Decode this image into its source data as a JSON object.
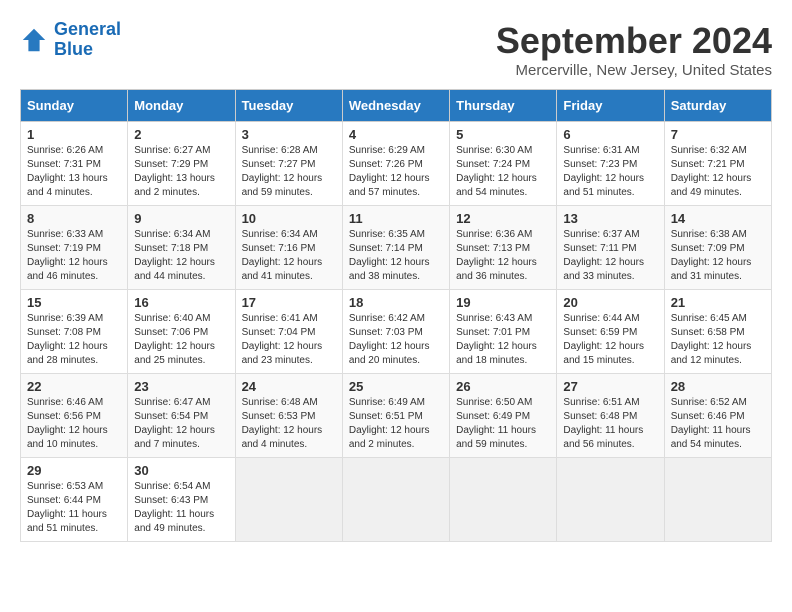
{
  "logo": {
    "line1": "General",
    "line2": "Blue"
  },
  "title": "September 2024",
  "location": "Mercerville, New Jersey, United States",
  "days_of_week": [
    "Sunday",
    "Monday",
    "Tuesday",
    "Wednesday",
    "Thursday",
    "Friday",
    "Saturday"
  ],
  "weeks": [
    [
      {
        "day": "1",
        "sunrise": "6:26 AM",
        "sunset": "7:31 PM",
        "daylight": "13 hours and 4 minutes."
      },
      {
        "day": "2",
        "sunrise": "6:27 AM",
        "sunset": "7:29 PM",
        "daylight": "13 hours and 2 minutes."
      },
      {
        "day": "3",
        "sunrise": "6:28 AM",
        "sunset": "7:27 PM",
        "daylight": "12 hours and 59 minutes."
      },
      {
        "day": "4",
        "sunrise": "6:29 AM",
        "sunset": "7:26 PM",
        "daylight": "12 hours and 57 minutes."
      },
      {
        "day": "5",
        "sunrise": "6:30 AM",
        "sunset": "7:24 PM",
        "daylight": "12 hours and 54 minutes."
      },
      {
        "day": "6",
        "sunrise": "6:31 AM",
        "sunset": "7:23 PM",
        "daylight": "12 hours and 51 minutes."
      },
      {
        "day": "7",
        "sunrise": "6:32 AM",
        "sunset": "7:21 PM",
        "daylight": "12 hours and 49 minutes."
      }
    ],
    [
      {
        "day": "8",
        "sunrise": "6:33 AM",
        "sunset": "7:19 PM",
        "daylight": "12 hours and 46 minutes."
      },
      {
        "day": "9",
        "sunrise": "6:34 AM",
        "sunset": "7:18 PM",
        "daylight": "12 hours and 44 minutes."
      },
      {
        "day": "10",
        "sunrise": "6:34 AM",
        "sunset": "7:16 PM",
        "daylight": "12 hours and 41 minutes."
      },
      {
        "day": "11",
        "sunrise": "6:35 AM",
        "sunset": "7:14 PM",
        "daylight": "12 hours and 38 minutes."
      },
      {
        "day": "12",
        "sunrise": "6:36 AM",
        "sunset": "7:13 PM",
        "daylight": "12 hours and 36 minutes."
      },
      {
        "day": "13",
        "sunrise": "6:37 AM",
        "sunset": "7:11 PM",
        "daylight": "12 hours and 33 minutes."
      },
      {
        "day": "14",
        "sunrise": "6:38 AM",
        "sunset": "7:09 PM",
        "daylight": "12 hours and 31 minutes."
      }
    ],
    [
      {
        "day": "15",
        "sunrise": "6:39 AM",
        "sunset": "7:08 PM",
        "daylight": "12 hours and 28 minutes."
      },
      {
        "day": "16",
        "sunrise": "6:40 AM",
        "sunset": "7:06 PM",
        "daylight": "12 hours and 25 minutes."
      },
      {
        "day": "17",
        "sunrise": "6:41 AM",
        "sunset": "7:04 PM",
        "daylight": "12 hours and 23 minutes."
      },
      {
        "day": "18",
        "sunrise": "6:42 AM",
        "sunset": "7:03 PM",
        "daylight": "12 hours and 20 minutes."
      },
      {
        "day": "19",
        "sunrise": "6:43 AM",
        "sunset": "7:01 PM",
        "daylight": "12 hours and 18 minutes."
      },
      {
        "day": "20",
        "sunrise": "6:44 AM",
        "sunset": "6:59 PM",
        "daylight": "12 hours and 15 minutes."
      },
      {
        "day": "21",
        "sunrise": "6:45 AM",
        "sunset": "6:58 PM",
        "daylight": "12 hours and 12 minutes."
      }
    ],
    [
      {
        "day": "22",
        "sunrise": "6:46 AM",
        "sunset": "6:56 PM",
        "daylight": "12 hours and 10 minutes."
      },
      {
        "day": "23",
        "sunrise": "6:47 AM",
        "sunset": "6:54 PM",
        "daylight": "12 hours and 7 minutes."
      },
      {
        "day": "24",
        "sunrise": "6:48 AM",
        "sunset": "6:53 PM",
        "daylight": "12 hours and 4 minutes."
      },
      {
        "day": "25",
        "sunrise": "6:49 AM",
        "sunset": "6:51 PM",
        "daylight": "12 hours and 2 minutes."
      },
      {
        "day": "26",
        "sunrise": "6:50 AM",
        "sunset": "6:49 PM",
        "daylight": "11 hours and 59 minutes."
      },
      {
        "day": "27",
        "sunrise": "6:51 AM",
        "sunset": "6:48 PM",
        "daylight": "11 hours and 56 minutes."
      },
      {
        "day": "28",
        "sunrise": "6:52 AM",
        "sunset": "6:46 PM",
        "daylight": "11 hours and 54 minutes."
      }
    ],
    [
      {
        "day": "29",
        "sunrise": "6:53 AM",
        "sunset": "6:44 PM",
        "daylight": "11 hours and 51 minutes."
      },
      {
        "day": "30",
        "sunrise": "6:54 AM",
        "sunset": "6:43 PM",
        "daylight": "11 hours and 49 minutes."
      },
      null,
      null,
      null,
      null,
      null
    ]
  ]
}
